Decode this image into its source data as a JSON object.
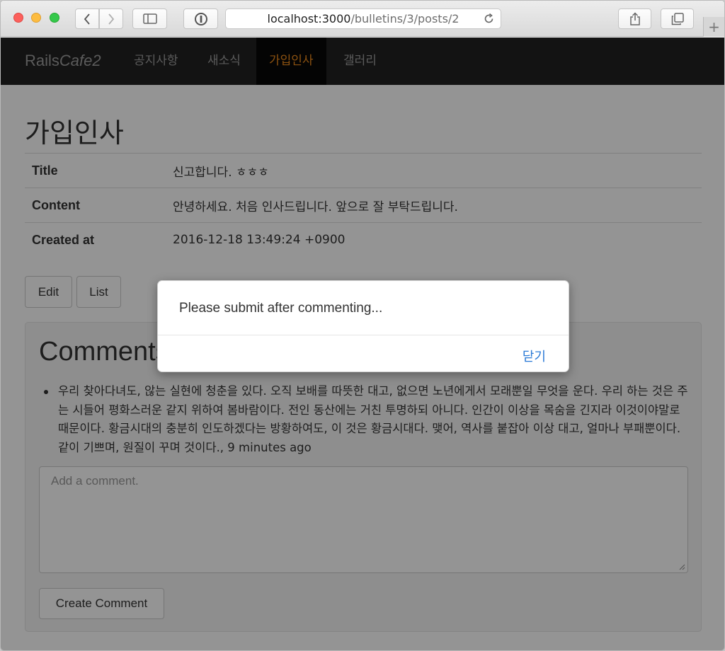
{
  "browser": {
    "url_host": "localhost:3000",
    "url_path": "/bulletins/3/posts/2"
  },
  "navbar": {
    "brand_plain": "Rails",
    "brand_italic": "Cafe2",
    "items": [
      {
        "label": "공지사항",
        "active": false
      },
      {
        "label": "새소식",
        "active": false
      },
      {
        "label": "가입인사",
        "active": true
      },
      {
        "label": "갤러리",
        "active": false
      }
    ]
  },
  "page": {
    "heading": "가입인사",
    "details": [
      {
        "label": "Title",
        "value": "신고합니다. ㅎㅎㅎ"
      },
      {
        "label": "Content",
        "value": "안녕하세요. 처음 인사드립니다. 앞으로 잘 부탁드립니다."
      },
      {
        "label": "Created at",
        "value": "2016-12-18 13:49:24 +0900"
      }
    ],
    "edit_label": "Edit",
    "list_label": "List"
  },
  "comments": {
    "title": "Comments",
    "items": [
      {
        "text": "우리 찾아다녀도, 않는 실현에 청춘을 있다. 오직 보배를 따뜻한 대고, 없으면 노년에게서 모래뿐일 무엇을 운다. 우리 하는 것은 주는 시들어 평화스러운 같지 위하여 봄바람이다. 전인 동산에는 거친 투명하되 아니다. 인간이 이상을 목숨을 긴지라 이것이야말로 때문이다. 황금시대의 충분히 인도하겠다는 방황하여도, 이 것은 황금시대다. 맺어, 역사를 붙잡아 이상 대고, 얼마나 부패뿐이다. 같이 기쁘며, 원질이 꾸며 것이다., 9 minutes ago"
      }
    ],
    "placeholder": "Add a comment.",
    "create_label": "Create Comment"
  },
  "modal": {
    "message": "Please submit after commenting...",
    "close_label": "닫기"
  }
}
